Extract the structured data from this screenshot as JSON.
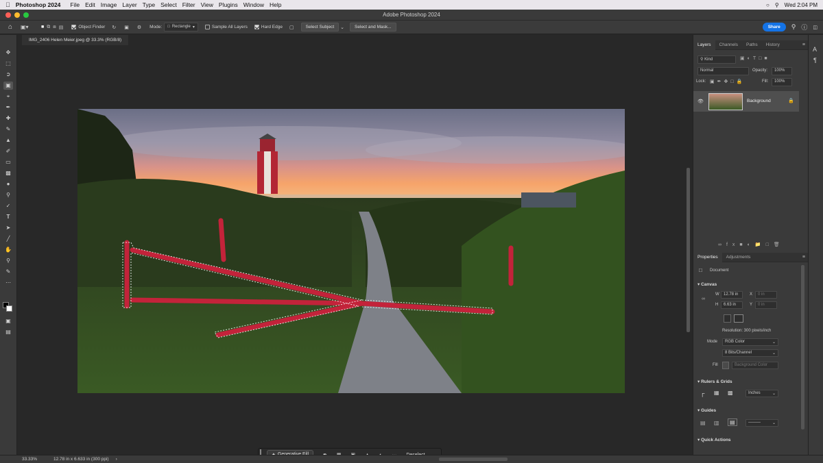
{
  "menubar": {
    "app": "Photoshop 2024",
    "items": [
      "File",
      "Edit",
      "Image",
      "Layer",
      "Type",
      "Select",
      "Filter",
      "View",
      "Plugins",
      "Window",
      "Help"
    ],
    "clock": "Wed 2:04 PM"
  },
  "window": {
    "title": "Adobe Photoshop 2024"
  },
  "options": {
    "object_finder": "Object Finder",
    "mode_label": "Mode:",
    "mode_value": "Rectangle",
    "sample_all_layers": "Sample All Layers",
    "hard_edge": "Hard Edge",
    "select_subject": "Select Subject",
    "select_and_mask": "Select and Mask...",
    "share": "Share"
  },
  "document": {
    "tab": "IMG_2406 Helen Meier.jpeg @ 33.3% (RGB/8)"
  },
  "layers_panel": {
    "tabs": [
      "Layers",
      "Channels",
      "Paths",
      "History"
    ],
    "kind_placeholder": "Kind",
    "blend_mode": "Normal",
    "opacity_label": "Opacity:",
    "opacity_value": "100%",
    "lock_label": "Lock:",
    "fill_label": "Fill:",
    "fill_value": "100%",
    "layer_name": "Background"
  },
  "properties_panel": {
    "tabs": [
      "Properties",
      "Adjustments"
    ],
    "document_label": "Document",
    "canvas_section": "Canvas",
    "w_label": "W",
    "w_value": "12.78 in",
    "h_label": "H",
    "h_value": "6.63 in",
    "x_label": "X",
    "y_label": "Y",
    "x_value": "0 in",
    "y_value": "0 in",
    "resolution": "Resolution: 300 pixels/inch",
    "mode_label": "Mode",
    "mode_value": "RGB Color",
    "bits_value": "8 Bits/Channel",
    "fill_label": "Fill",
    "fill_value": "Background Color",
    "rulers_section": "Rulers & Grids",
    "units_value": "Inches",
    "guides_section": "Guides",
    "quick_actions_section": "Quick Actions"
  },
  "statusbar": {
    "zoom": "33.33%",
    "doc_info": "12.78 in x 6.633 in (300 ppi)"
  },
  "context_bar": {
    "generative_fill": "Generative Fill",
    "deselect": "Deselect",
    "more": "···"
  },
  "colors": {
    "accent": "#1473e6",
    "panel_bg": "#3a3a3a",
    "canvas_bg": "#282828"
  }
}
